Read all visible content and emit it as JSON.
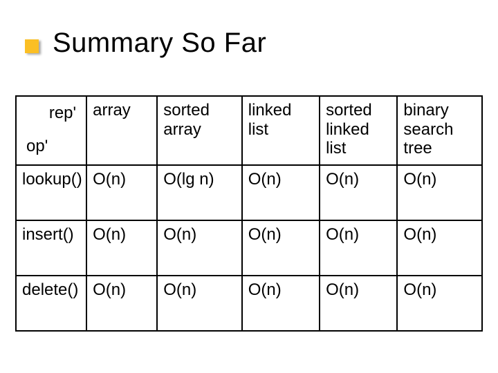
{
  "title": "Summary So Far",
  "header_cell": {
    "rep": "rep'",
    "op": "op'"
  },
  "columns": [
    "array",
    "sorted array",
    "linked list",
    "sorted linked list",
    "binary search tree"
  ],
  "rows": [
    {
      "label": "lookup()",
      "values": [
        "O(n)",
        "O(lg n)",
        "O(n)",
        "O(n)",
        "O(n)"
      ]
    },
    {
      "label": "insert()",
      "values": [
        "O(n)",
        "O(n)",
        "O(n)",
        "O(n)",
        "O(n)"
      ]
    },
    {
      "label": "delete()",
      "values": [
        "O(n)",
        "O(n)",
        "O(n)",
        "O(n)",
        "O(n)"
      ]
    }
  ]
}
